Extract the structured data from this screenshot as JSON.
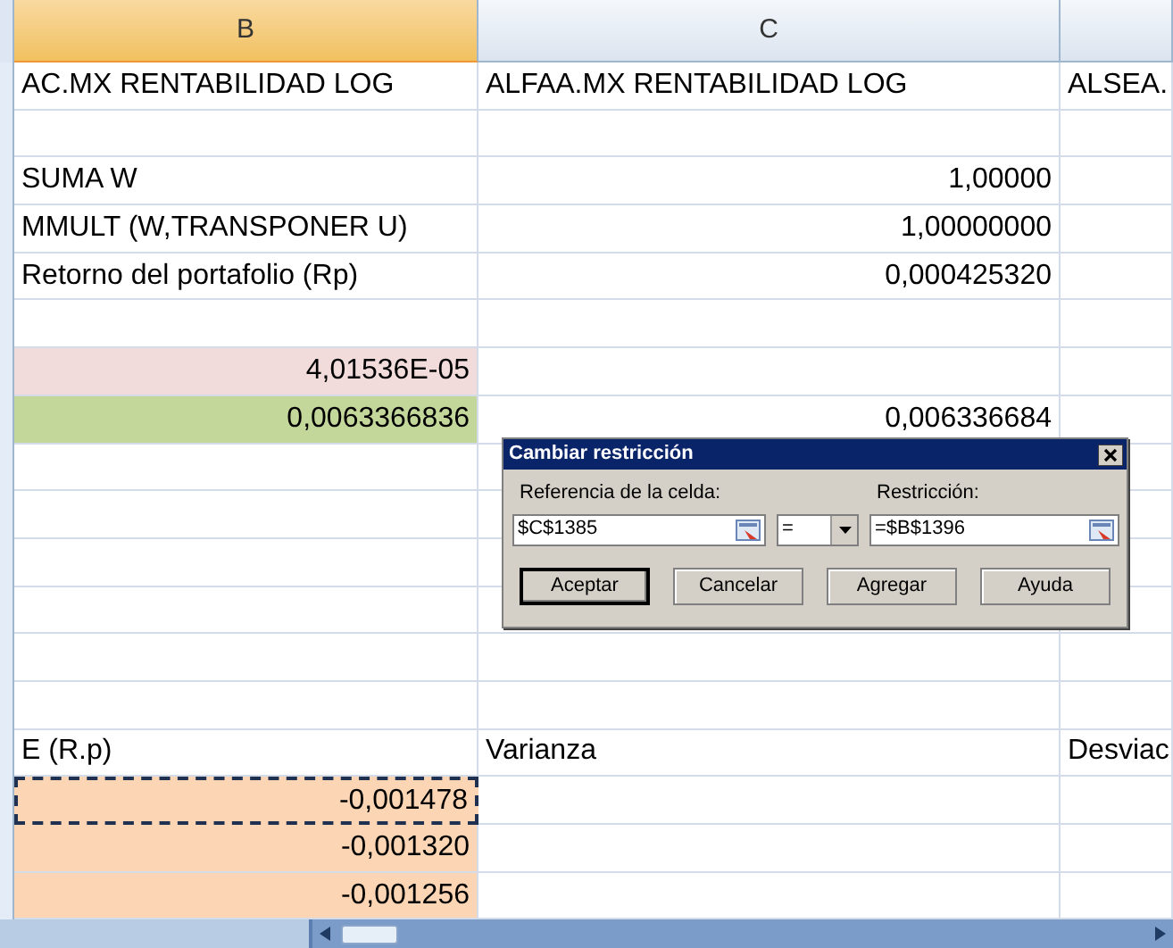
{
  "columns": [
    {
      "label": "B",
      "selected": true
    },
    {
      "label": "C",
      "selected": false
    },
    {
      "selected": false
    }
  ],
  "rows": [
    {
      "cells": [
        {
          "text": "AC.MX RENTABILIDAD LOG",
          "kind": "text",
          "marked": false
        },
        {
          "text": "ALFAA.MX RENTABILIDAD LOG",
          "kind": "text",
          "marked": false
        },
        {
          "text": "ALSEA.",
          "kind": "text",
          "marked": false
        }
      ]
    },
    {
      "cells": [
        {
          "marked": false
        },
        {
          "marked": false
        },
        {
          "marked": false
        }
      ]
    },
    {
      "cells": [
        {
          "text": "SUMA W",
          "kind": "text",
          "marked": false
        },
        {
          "text": "1,00000",
          "kind": "number",
          "marked": false
        },
        {
          "marked": false
        }
      ]
    },
    {
      "cells": [
        {
          "text": "MMULT (W,TRANSPONER U)",
          "kind": "text",
          "marked": false
        },
        {
          "text": "1,00000000",
          "kind": "number",
          "marked": false
        },
        {
          "marked": false
        }
      ]
    },
    {
      "cells": [
        {
          "text": "Retorno del portafolio (Rp)",
          "kind": "text",
          "marked": false
        },
        {
          "text": "0,000425320",
          "kind": "number",
          "marked": false
        },
        {
          "marked": false
        }
      ]
    },
    {
      "cells": [
        {
          "marked": false
        },
        {
          "marked": false
        },
        {
          "marked": false
        }
      ]
    },
    {
      "cells": [
        {
          "text": "4,01536E-05",
          "kind": "number",
          "color": "#f2dcdb",
          "marked": false
        },
        {
          "marked": false
        },
        {
          "marked": false
        }
      ]
    },
    {
      "cells": [
        {
          "text": "0,0063366836",
          "kind": "number",
          "color": "#c4d79b",
          "marked": false
        },
        {
          "text": "0,006336684",
          "kind": "number",
          "marked": false
        },
        {
          "marked": false
        }
      ]
    },
    {
      "cells": [
        {
          "marked": false
        },
        {
          "marked": false
        },
        {
          "marked": false
        }
      ]
    },
    {
      "cells": [
        {
          "marked": false
        },
        {
          "marked": false
        },
        {
          "marked": false
        }
      ]
    },
    {
      "cells": [
        {
          "marked": false
        },
        {
          "marked": false
        },
        {
          "marked": false
        }
      ]
    },
    {
      "cells": [
        {
          "marked": false
        },
        {
          "marked": false
        },
        {
          "marked": false
        }
      ]
    },
    {
      "cells": [
        {
          "marked": false
        },
        {
          "marked": false
        },
        {
          "marked": false
        }
      ]
    },
    {
      "cells": [
        {
          "marked": false
        },
        {
          "marked": false
        },
        {
          "marked": false
        }
      ]
    },
    {
      "cells": [
        {
          "text": "E (R.p)",
          "kind": "text",
          "marked": false
        },
        {
          "text": "Varianza",
          "kind": "text",
          "marked": false
        },
        {
          "text": "Desviac",
          "kind": "text",
          "marked": false
        }
      ]
    },
    {
      "cells": [
        {
          "text": "-0,001478",
          "kind": "number",
          "color": "#fcd5b4",
          "marked": true
        },
        {
          "marked": false
        },
        {
          "marked": false
        }
      ]
    },
    {
      "cells": [
        {
          "text": "-0,001320",
          "kind": "number",
          "color": "#fcd5b4",
          "marked": false
        },
        {
          "marked": false
        },
        {
          "marked": false
        }
      ]
    },
    {
      "cells": [
        {
          "text": "-0,001256",
          "kind": "number",
          "color": "#fcd5b4",
          "marked": false
        },
        {
          "marked": false
        },
        {
          "marked": false
        }
      ]
    }
  ],
  "dialog": {
    "title": "Cambiar restricción",
    "reference_label": "Referencia de la celda:",
    "reference_value": "$C$1385",
    "operator": "=",
    "restriction_label": "Restricción:",
    "restriction_value": "=$B$1396",
    "buttons": [
      {
        "label": "Aceptar",
        "default": true
      },
      {
        "label": "Cancelar",
        "default": false
      },
      {
        "label": "Agregar",
        "default": false
      },
      {
        "label": "Ayuda",
        "default": false
      }
    ]
  }
}
